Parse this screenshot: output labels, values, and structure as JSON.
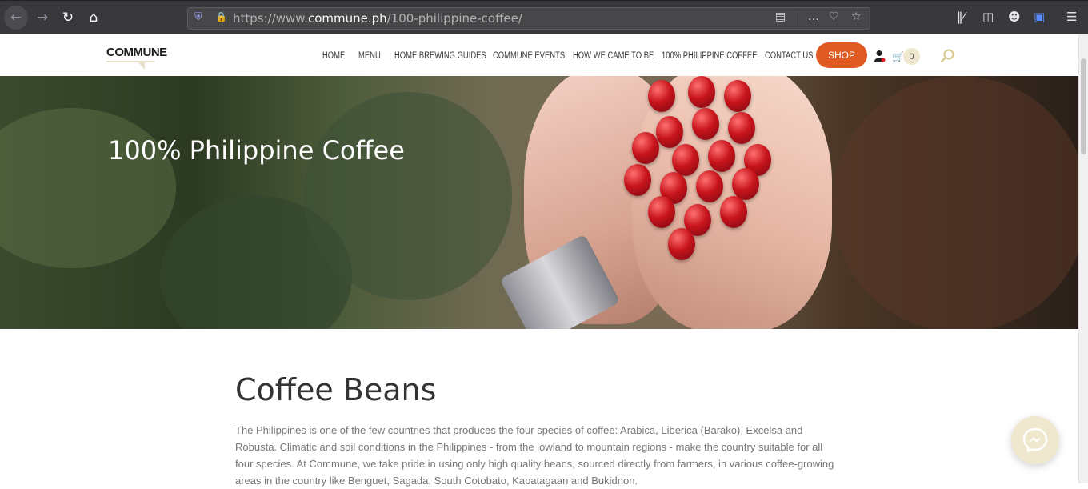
{
  "browser": {
    "url_prefix": "https://www.",
    "url_host": "commune.ph",
    "url_path": "/100-philippine-coffee/"
  },
  "site": {
    "logo_text": "COMMUNE",
    "nav_items": [
      "HOME",
      "MENU",
      "HOME BREWING GUIDES",
      "COMMUNE EVENTS",
      "HOW WE CAME TO BE",
      "100% PHILIPPINE COFFEE",
      "CONTACT US"
    ],
    "shop_label": "SHOP",
    "cart_count": "0",
    "accent_color": "#e05a24",
    "cream_color": "#efe8cf"
  },
  "hero": {
    "title": "100% Philippine Coffee"
  },
  "content": {
    "heading": "Coffee Beans",
    "paragraph": "The Philippines is one of the few countries that produces the four species of coffee: Arabica, Liberica (Barako), Excelsa and Robusta. Climatic and soil conditions in the Philippines - from the lowland to mountain regions - make the country suitable for all four species. At Commune, we take pride in using only high quality beans, sourced directly from farmers, in various coffee-growing areas in the country like Benguet, Sagada, South Cotobato, Kapatagaan and Bukidnon."
  },
  "icons": {
    "back": "back-arrow-icon",
    "forward": "forward-arrow-icon",
    "reload": "reload-icon",
    "home": "home-icon",
    "user": "user-icon",
    "cart": "cart-icon",
    "search": "search-icon",
    "messenger": "messenger-icon"
  }
}
